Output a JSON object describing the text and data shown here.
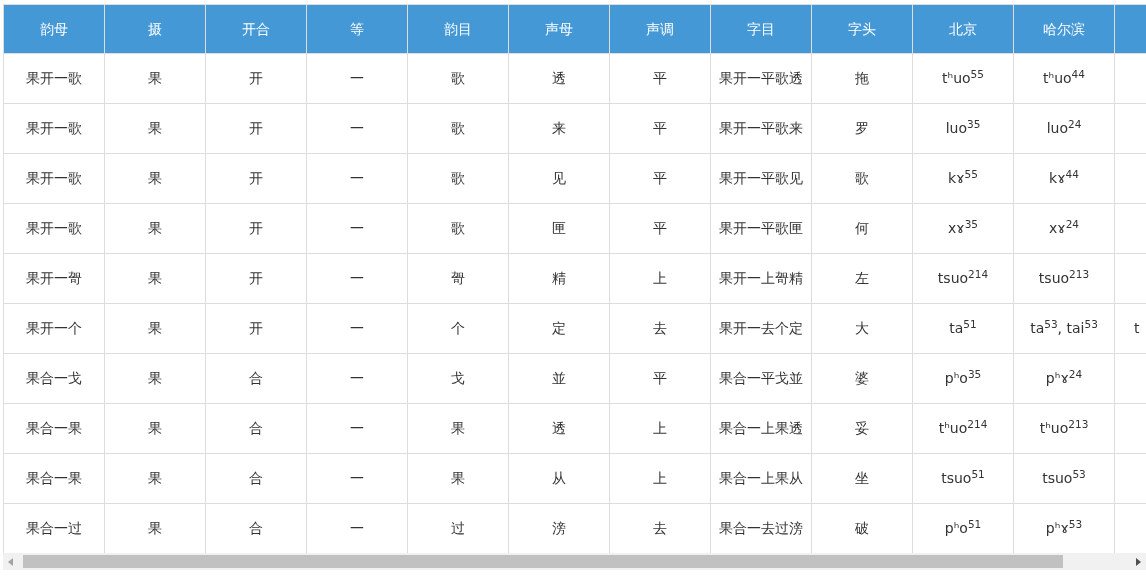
{
  "table": {
    "columns": [
      "韵母",
      "摄",
      "开合",
      "等",
      "韵目",
      "声母",
      "声调",
      "字目",
      "字头",
      "北京",
      "哈尔滨"
    ],
    "rows": [
      {
        "cells": [
          "果开一歌",
          "果",
          "开",
          "一",
          "歌",
          "透",
          "平",
          "果开一平歌透",
          "拖",
          "tʰuo$^{55}$",
          "tʰuo$^{44}$"
        ]
      },
      {
        "cells": [
          "果开一歌",
          "果",
          "开",
          "一",
          "歌",
          "来",
          "平",
          "果开一平歌来",
          "罗",
          "luo$^{35}$",
          "luo$^{24}$"
        ]
      },
      {
        "cells": [
          "果开一歌",
          "果",
          "开",
          "一",
          "歌",
          "见",
          "平",
          "果开一平歌见",
          "歌",
          "kɤ$^{55}$",
          "kɤ$^{44}$"
        ]
      },
      {
        "cells": [
          "果开一歌",
          "果",
          "开",
          "一",
          "歌",
          "匣",
          "平",
          "果开一平歌匣",
          "何",
          "xɤ$^{35}$",
          "xɤ$^{24}$"
        ]
      },
      {
        "cells": [
          "果开一哿",
          "果",
          "开",
          "一",
          "哿",
          "精",
          "上",
          "果开一上哿精",
          "左",
          "tsuo$^{214}$",
          "tsuo$^{213}$"
        ]
      },
      {
        "cells": [
          "果开一个",
          "果",
          "开",
          "一",
          "个",
          "定",
          "去",
          "果开一去个定",
          "大",
          "ta$^{51}$",
          "ta$^{53}$, tai$^{53}$"
        ],
        "column_12": "t"
      },
      {
        "cells": [
          "果合一戈",
          "果",
          "合",
          "一",
          "戈",
          "並",
          "平",
          "果合一平戈並",
          "婆",
          "pʰo$^{35}$",
          "pʰɤ$^{24}$"
        ]
      },
      {
        "cells": [
          "果合一果",
          "果",
          "合",
          "一",
          "果",
          "透",
          "上",
          "果合一上果透",
          "妥",
          "tʰuo$^{214}$",
          "tʰuo$^{213}$"
        ]
      },
      {
        "cells": [
          "果合一果",
          "果",
          "合",
          "一",
          "果",
          "从",
          "上",
          "果合一上果从",
          "坐",
          "tsuo$^{51}$",
          "tsuo$^{53}$"
        ]
      },
      {
        "cells": [
          "果合一过",
          "果",
          "合",
          "一",
          "过",
          "滂",
          "去",
          "果合一去过滂",
          "破",
          "pʰo$^{51}$",
          "pʰɤ$^{53}$"
        ]
      }
    ]
  }
}
